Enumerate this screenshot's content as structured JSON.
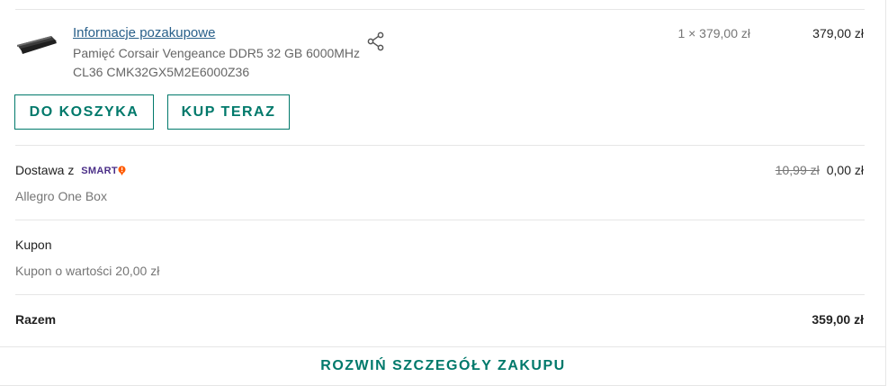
{
  "item": {
    "info_link": "Informacje pozakupowe",
    "name": "Pamięć Corsair Vengeance DDR5 32 GB 6000MHz CL36 CMK32GX5M2E6000Z36",
    "quantity_text": "1 × 379,00 zł",
    "price": "379,00 zł",
    "image_icon": "ram-module-image",
    "share_icon": "share-icon"
  },
  "actions": {
    "cart_label": "DO KOSZYKA",
    "buy_label": "KUP TERAZ"
  },
  "delivery": {
    "label": "Dostawa z",
    "smart_label": "SMART",
    "method": "Allegro One Box",
    "old_price": "10,99 zł",
    "new_price": "0,00 zł"
  },
  "coupon": {
    "label": "Kupon",
    "description": "Kupon o wartości 20,00 zł"
  },
  "total": {
    "label": "Razem",
    "value": "359,00 zł"
  },
  "footer": {
    "expand_label": "ROZWIŃ SZCZEGÓŁY ZAKUPU"
  },
  "colors": {
    "accent": "#00796b",
    "link": "#29608a",
    "smart": "#4b2f88",
    "smart_badge": "#ff5a00"
  }
}
